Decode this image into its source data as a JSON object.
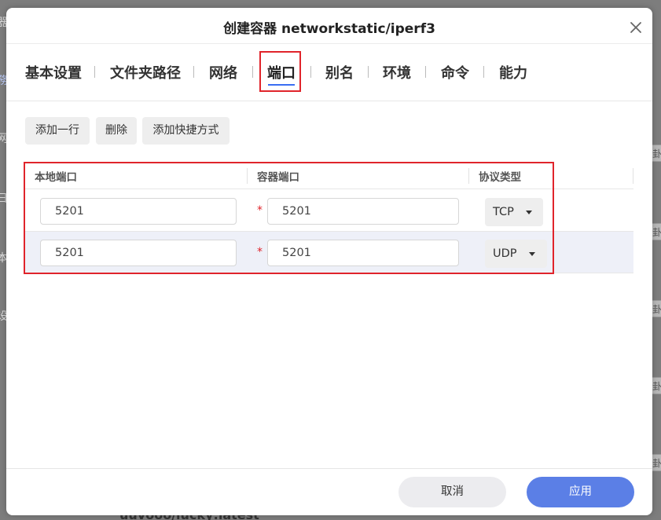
{
  "background": {
    "left_glyphs": [
      "器",
      "務",
      "网",
      "日",
      "本",
      "设"
    ],
    "right_glyph": "卦",
    "bottom_text": "uuvooo/lucky:latest"
  },
  "dialog": {
    "title": "创建容器 networkstatic/iperf3",
    "close_icon": "close-icon"
  },
  "tabs": [
    {
      "label": "基本设置"
    },
    {
      "label": "文件夹路径"
    },
    {
      "label": "网络"
    },
    {
      "label": "端口",
      "active": true
    },
    {
      "label": "别名"
    },
    {
      "label": "环境"
    },
    {
      "label": "命令"
    },
    {
      "label": "能力"
    }
  ],
  "toolbar": {
    "add_row": "添加一行",
    "delete": "删除",
    "add_shortcut": "添加快捷方式"
  },
  "table": {
    "columns": [
      "本地端口",
      "容器端口",
      "协议类型"
    ],
    "required_mark": "*",
    "rows": [
      {
        "local_port": "5201",
        "container_port": "5201",
        "protocol": "TCP"
      },
      {
        "local_port": "5201",
        "container_port": "5201",
        "protocol": "UDP"
      }
    ]
  },
  "footer": {
    "cancel": "取消",
    "apply": "应用"
  },
  "colors": {
    "accent": "#5b7fe6",
    "highlight_box": "#e0242b",
    "active_tab_underline": "#3a6ef2"
  }
}
